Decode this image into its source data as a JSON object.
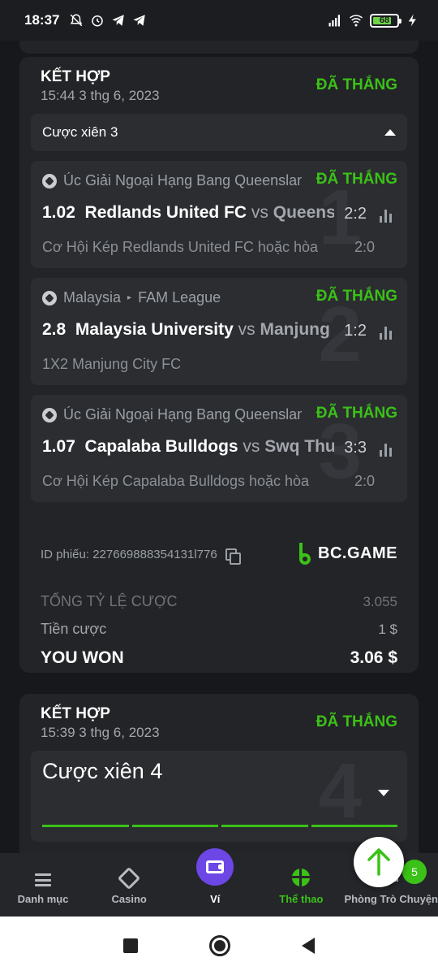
{
  "status_bar": {
    "time": "18:37",
    "battery": "68",
    "left_icons": [
      "notifications-off-icon",
      "alarm-icon",
      "telegram-icon",
      "telegram-icon"
    ],
    "right_icons": [
      "signal-icon",
      "wifi-icon",
      "battery-icon",
      "charging-icon"
    ]
  },
  "bets": [
    {
      "title": "KẾT HỢP",
      "date": "15:44 3 thg 6, 2023",
      "status": "ĐÃ THẮNG",
      "parlay_label": "Cược xiên 3",
      "legs": [
        {
          "number": "1",
          "league": "Úc Giải Ngoại Hạng Bang Queensland",
          "status": "ĐÃ THẮNG",
          "odds": "1.02",
          "home": "Redlands United FC",
          "vs": "vs",
          "away": "Queensland Lions",
          "score": "2:2",
          "market": "Cơ Hội Kép Redlands United FC hoặc hòa",
          "market_score": "2:0"
        },
        {
          "number": "2",
          "league_country": "Malaysia",
          "league_name": "FAM League",
          "status": "ĐÃ THẮNG",
          "odds": "2.8",
          "home": "Malaysia University",
          "vs": "vs",
          "away": "Manjung City FC",
          "score": "1:2",
          "market": "1X2 Manjung City FC",
          "market_score": ""
        },
        {
          "number": "3",
          "league": "Úc Giải Ngoại Hạng Bang Queensland",
          "status": "ĐÃ THẮNG",
          "odds": "1.07",
          "home": "Capalaba Bulldogs",
          "vs": "vs",
          "away": "Swq Thunder",
          "score": "3:3",
          "market": "Cơ Hội Kép Capalaba Bulldogs hoặc hòa",
          "market_score": "2:0"
        }
      ],
      "ticket_id": "ID phiếu: 227669888354131l776",
      "brand": "BC.GAME",
      "total_odds_label": "TỔNG TỶ LỆ CƯỢC",
      "total_odds_value": "3.055",
      "stake_label": "Tiền cược",
      "stake_value": "1 $",
      "won_label": "YOU WON",
      "won_value": "3.06 $"
    },
    {
      "title": "KẾT HỢP",
      "date": "15:39 3 thg 6, 2023",
      "status": "ĐÃ THẮNG",
      "parlay_label": "Cược xiên 4",
      "big_number": "4"
    }
  ],
  "bottom_nav": [
    {
      "label": "Danh mục",
      "icon": "menu-icon"
    },
    {
      "label": "Casino",
      "icon": "casino-icon"
    },
    {
      "label": "Ví",
      "icon": "wallet-icon"
    },
    {
      "label": "Thể thao",
      "icon": "basketball-icon"
    },
    {
      "label": "Phòng Trò Chuyện",
      "icon": "chat-icon",
      "badge": "5"
    }
  ],
  "colors": {
    "accent_green": "#3bc117",
    "wallet_purple": "#6c47e6",
    "card_bg": "#232427",
    "page_bg": "#17181b"
  }
}
